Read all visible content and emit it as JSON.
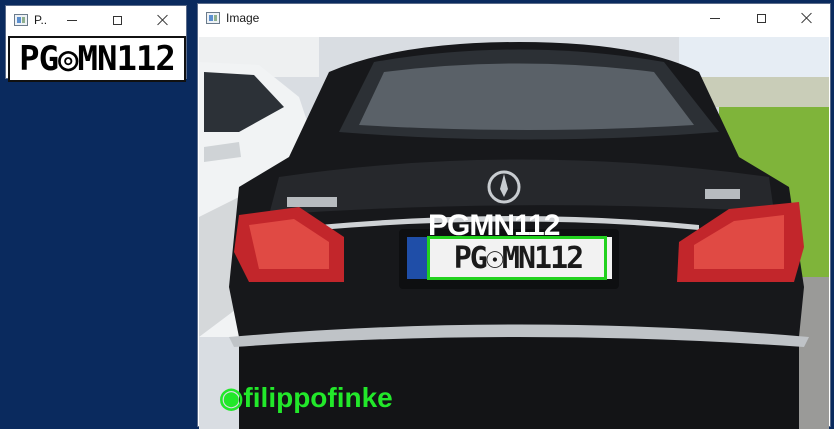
{
  "plate_window": {
    "title": "P..",
    "plate_text": "PG◎MN112"
  },
  "image_window": {
    "title": "Image",
    "detection_label": "PGMN112",
    "plate_text": "PG☉MN112",
    "watermark": "◉filippofinke"
  },
  "colors": {
    "desktop": "#0a2a5e",
    "bbox": "#22d11e",
    "watermark": "#22e82a"
  }
}
